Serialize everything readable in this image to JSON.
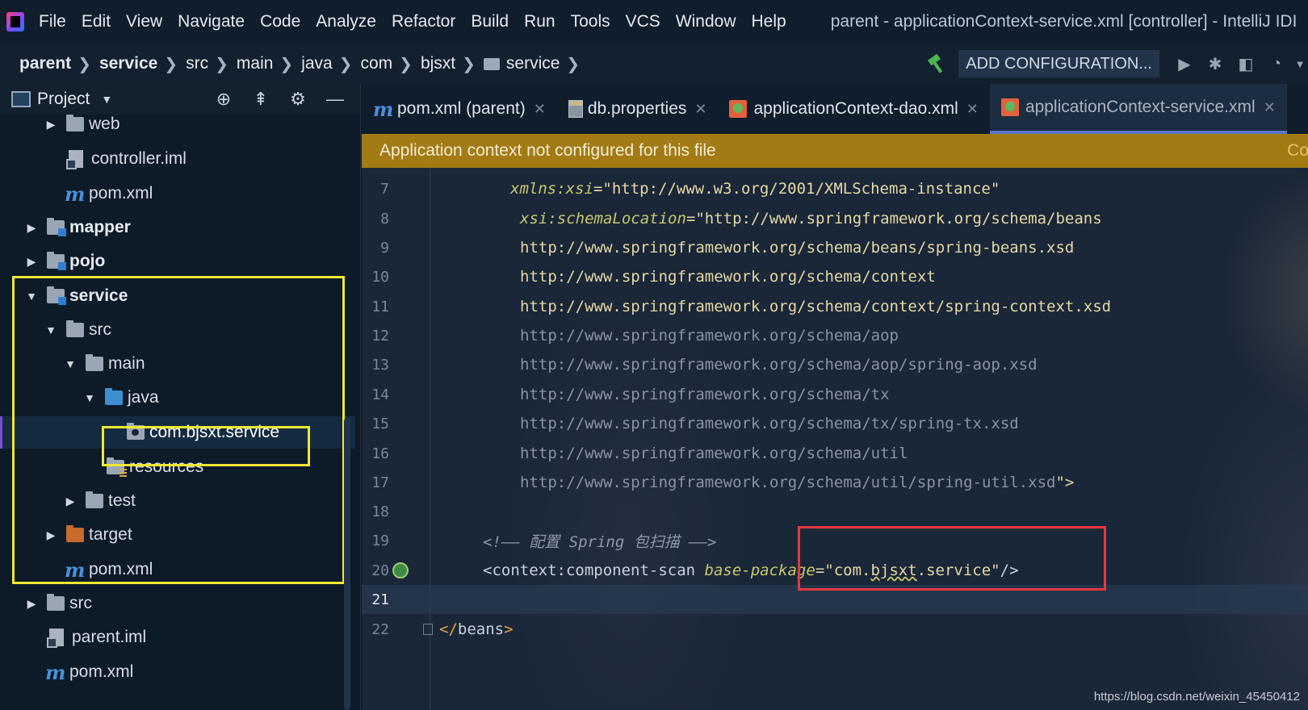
{
  "menubar": {
    "items": [
      "File",
      "Edit",
      "View",
      "Navigate",
      "Code",
      "Analyze",
      "Refactor",
      "Build",
      "Run",
      "Tools",
      "VCS",
      "Window",
      "Help"
    ],
    "title": "parent - applicationContext-service.xml [controller] - IntelliJ IDI"
  },
  "navbar": {
    "crumbs": [
      "parent",
      "service",
      "src",
      "main",
      "java",
      "com",
      "bjsxt",
      "service"
    ],
    "add_config": "ADD CONFIGURATION..."
  },
  "project": {
    "title": "Project",
    "tree": [
      {
        "label": "web",
        "icon": "folder-icon"
      },
      {
        "label": "controller.iml",
        "icon": "iml-file-icon"
      },
      {
        "label": "pom.xml",
        "icon": "maven-icon"
      },
      {
        "label": "mapper",
        "icon": "module-folder-icon"
      },
      {
        "label": "pojo",
        "icon": "module-folder-icon"
      },
      {
        "label": "service",
        "icon": "module-folder-icon"
      },
      {
        "label": "src",
        "icon": "folder-icon"
      },
      {
        "label": "main",
        "icon": "folder-icon"
      },
      {
        "label": "java",
        "icon": "source-folder-icon"
      },
      {
        "label": "com.bjsxt.service",
        "icon": "package-icon"
      },
      {
        "label": "resources",
        "icon": "resources-folder-icon"
      },
      {
        "label": "test",
        "icon": "folder-icon"
      },
      {
        "label": "target",
        "icon": "excluded-folder-icon"
      },
      {
        "label": "pom.xml",
        "icon": "maven-icon"
      },
      {
        "label": "src",
        "icon": "folder-icon"
      },
      {
        "label": "parent.iml",
        "icon": "iml-file-icon"
      },
      {
        "label": "pom.xml",
        "icon": "maven-icon"
      }
    ]
  },
  "tabs": [
    {
      "label": "pom.xml (parent)",
      "icon": "maven-icon"
    },
    {
      "label": "db.properties",
      "icon": "properties-icon"
    },
    {
      "label": "applicationContext-dao.xml",
      "icon": "spring-xml-icon"
    },
    {
      "label": "applicationContext-service.xml",
      "icon": "spring-xml-icon",
      "active": true
    }
  ],
  "banner": {
    "message": "Application context not configured for this file",
    "link": "Cor"
  },
  "editor": {
    "line_numbers": [
      "7",
      "8",
      "9",
      "10",
      "11",
      "12",
      "13",
      "14",
      "15",
      "16",
      "17",
      "18",
      "19",
      "20",
      "21",
      "22"
    ],
    "l7_attr": "xmlns:xsi",
    "l7_val": "=\"http://www.w3.org/2001/XMLSchema-instance\"",
    "l8_attr": "xsi:schemaLocation",
    "l8_val": "=\"http://www.springframework.org/schema/beans",
    "l9": "http://www.springframework.org/schema/beans/spring-beans.xsd",
    "l10": "http://www.springframework.org/schema/context",
    "l11": "http://www.springframework.org/schema/context/spring-context.xsd",
    "l12": "http://www.springframework.org/schema/aop",
    "l13": "http://www.springframework.org/schema/aop/spring-aop.xsd",
    "l14": "http://www.springframework.org/schema/tx",
    "l15": "http://www.springframework.org/schema/tx/spring-tx.xsd",
    "l16": "http://www.springframework.org/schema/util",
    "l17": "http://www.springframework.org/schema/util/spring-util.xsd",
    "l17_end": "\">",
    "l19_comment": "<!—— 配置 Spring 包扫描 ——>",
    "l20_open": "<context:component-scan ",
    "l20_attr": "base-package",
    "l20_eq": "=\"com.",
    "l20_squiggle": "bjsxt",
    "l20_rest": ".service\"",
    "l20_close": "/>",
    "l22_open": "</",
    "l22_name": "beans",
    "l22_close": ">"
  },
  "watermark": "https://blog.csdn.net/weixin_45450412"
}
